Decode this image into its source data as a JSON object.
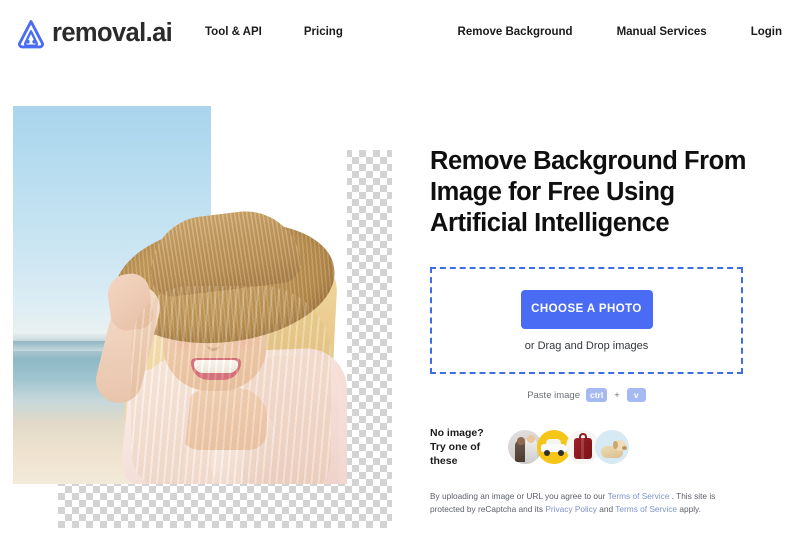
{
  "brand": {
    "name": "removal.ai",
    "logo_icon": "removal-ai-logo-icon",
    "logo_color": "#4a6cf5"
  },
  "nav": {
    "left_links": [
      {
        "label": "Tool & API"
      },
      {
        "label": "Pricing"
      }
    ],
    "right_links": [
      {
        "label": "Remove Background"
      },
      {
        "label": "Manual Services"
      },
      {
        "label": "Login"
      }
    ]
  },
  "hero": {
    "headline": "Remove Background From\nImage for Free Using\nArtificial Intelligence",
    "preview_alt": "smiling blonde woman in straw hat at the beach with background removed",
    "checkerboard_label": "transparent-background-checkerboard"
  },
  "upload": {
    "button_label": "CHOOSE A PHOTO",
    "drag_drop_label": "or Drag and Drop images",
    "button_color": "#4a6cf5",
    "dropzone_border_color": "#3d6fe0"
  },
  "paste": {
    "label": "Paste image",
    "key_1": "ctrl",
    "separator": "+",
    "key_2": "v",
    "chip_color": "#a6b9f2"
  },
  "samples": {
    "line1": "No image?",
    "line2": "Try one of these",
    "thumbnails": [
      {
        "name": "sample-couple",
        "icon": "couple-photo-icon"
      },
      {
        "name": "sample-car",
        "icon": "car-photo-icon"
      },
      {
        "name": "sample-suitcase",
        "icon": "suitcase-photo-icon"
      },
      {
        "name": "sample-dog",
        "icon": "dog-photo-icon"
      }
    ]
  },
  "legal": {
    "part1": "By uploading an image or URL you agree to our ",
    "link1": "Terms of Service",
    "part2": " . This site is protected by reCaptcha and its ",
    "link2": "Privacy Policy",
    "part3": " and ",
    "link3": "Terms of Service",
    "part4": " apply.",
    "link_color": "#7d93c9"
  }
}
